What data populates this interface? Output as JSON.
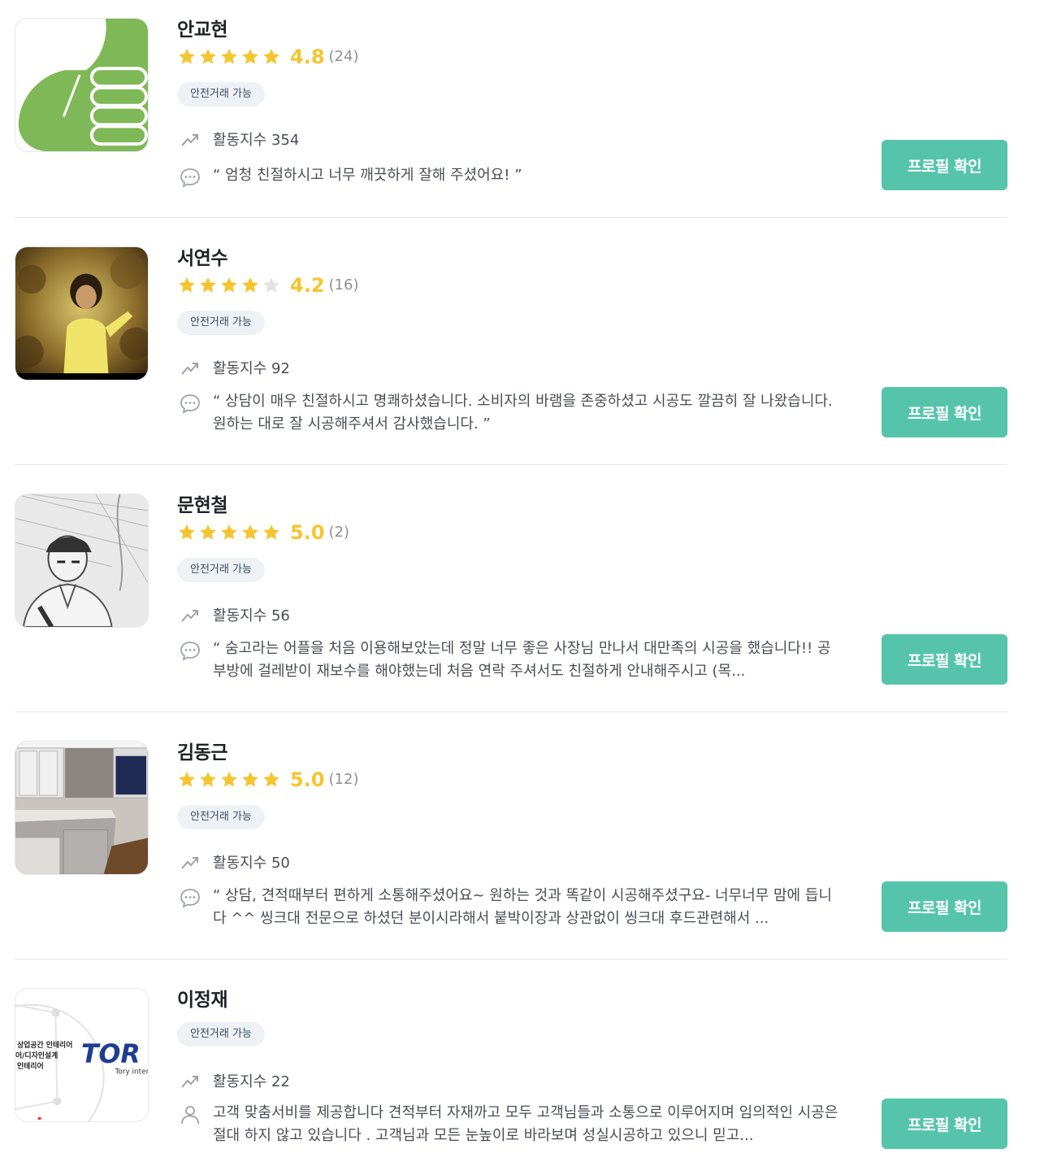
{
  "cards": [
    {
      "name": "안교현",
      "rating": 4.8,
      "score_label": "4.8",
      "review_count": "(24)",
      "badge": "안전거래 가능",
      "activity": "활동지수 354",
      "comment_icon": "chat-bubble-icon",
      "review": "“ 엄청 친절하시고 너무 깨끗하게 잘해 주셨어요! ”",
      "button": "프로필 확인",
      "avatar": "thumbs-up-image"
    },
    {
      "name": "서연수",
      "rating": 4.2,
      "score_label": "4.2",
      "review_count": "(16)",
      "badge": "안전거래 가능",
      "activity": "활동지수 92",
      "comment_icon": "chat-bubble-icon",
      "review": "“ 상담이 매우 친절하시고 명쾌하셨습니다. 소비자의 바램을 존중하셨고 시공도 깔끔히 잘 나왔습니다. 원하는 대로 잘 시공해주셔서 감사했습니다. ”",
      "button": "프로필 확인",
      "avatar": "person-photo"
    },
    {
      "name": "문현철",
      "rating": 5.0,
      "score_label": "5.0",
      "review_count": "(2)",
      "badge": "안전거래 가능",
      "activity": "활동지수 56",
      "comment_icon": "chat-bubble-icon",
      "review": "“ 숨고라는 어플을 처음 이용해보았는데 정말 너무 좋은 사장님 만나서 대만족의 시공을 했습니다!! 공부방에 걸레받이 재보수를 해야했는데 처음 연락 주셔서도 친절하게 안내해주시고 (목...",
      "button": "프로필 확인",
      "avatar": "sketch-portrait"
    },
    {
      "name": "김동근",
      "rating": 5.0,
      "score_label": "5.0",
      "review_count": "(12)",
      "badge": "안전거래 가능",
      "activity": "활동지수 50",
      "comment_icon": "chat-bubble-icon",
      "review": "“ 상담, 견적때부터 편하게 소통해주셨어요~ 원하는 것과 똑같이 시공해주셨구요- 너무너무 맘에 듭니다 ^^ 씽크대 전문으로 하셨던 분이시라해서 붙박이장과 상관없이 씽크대 후드관련해서 ...",
      "button": "프로필 확인",
      "avatar": "kitchen-photo"
    },
    {
      "name": "이정재",
      "rating": null,
      "score_label": "",
      "review_count": "",
      "badge": "안전거래 가능",
      "activity": "활동지수 22",
      "comment_icon": "person-icon",
      "review": "고객 맞춤서비를 제공합니다 견적부터 자재까고 모두 고객님들과 소통으로 이루어지며 임의적인 시공은 절대 하지 않고 있습니다 . 고객님과 모든 눈높이로 바라보며 성실시공하고 있으니 믿고...",
      "button": "프로필 확인",
      "avatar": "company-logo",
      "logo_text": {
        "line1": "상업공간 인테리어",
        "line2": "어/디자인설계",
        "line3": "인테리어",
        "brand": "TOR",
        "sub": "Tory inter"
      }
    }
  ],
  "colors": {
    "accent": "#55c4ab",
    "star": "#f5c530",
    "star_empty": "#e3e3e3",
    "badge_bg": "#eef2f6"
  }
}
